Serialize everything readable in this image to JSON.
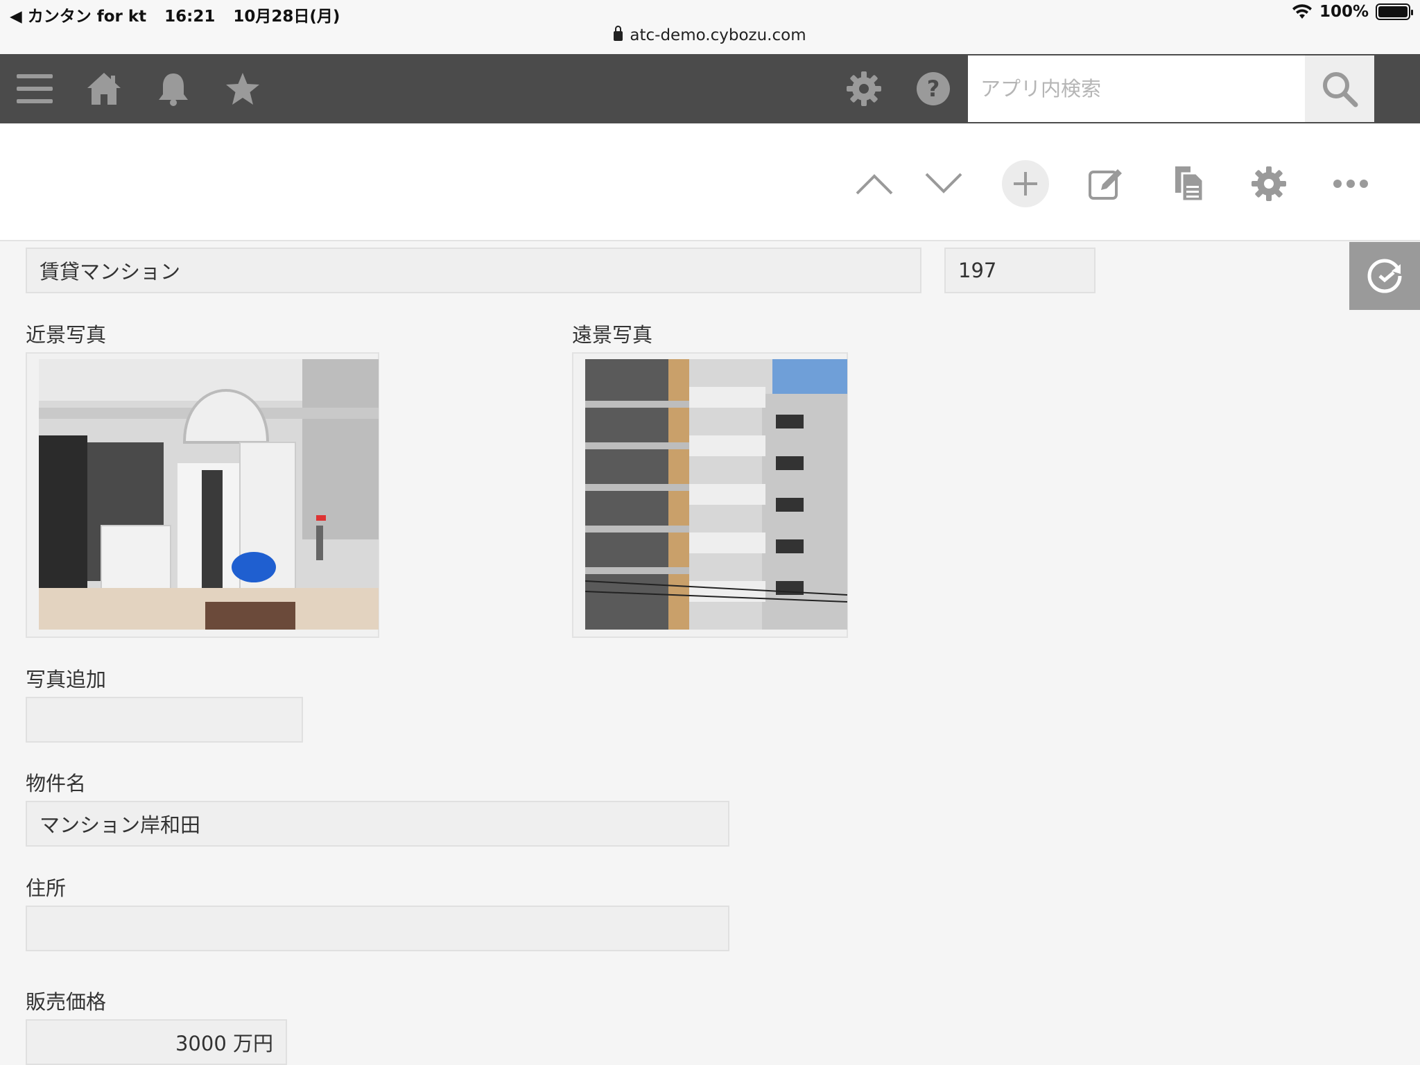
{
  "status_bar": {
    "back_app": "◀ カンタン for kt",
    "time": "16:21",
    "date": "10月28日(月)",
    "battery": "100%",
    "url": "atc-demo.cybozu.com"
  },
  "appbar": {
    "search_placeholder": "アプリ内検索"
  },
  "record": {
    "category": "賃貸マンション",
    "record_number": "197",
    "near_photo_label": "近景写真",
    "far_photo_label": "遠景写真",
    "add_photo_label": "写真追加",
    "add_photo_value": "",
    "property_name_label": "物件名",
    "property_name_value": "マンション岸和田",
    "address_label": "住所",
    "address_value": "",
    "price_label": "販売価格",
    "price_value": "3000 万円"
  },
  "colors": {
    "appbar_bg": "#4b4b4b",
    "icon_gray": "#9a9a9a",
    "field_bg": "#efefef"
  }
}
